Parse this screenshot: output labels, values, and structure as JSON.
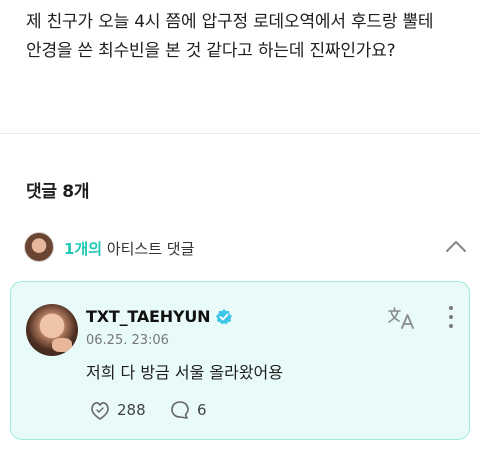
{
  "post": {
    "text": "제 친구가 오늘 4시 쯤에 압구정 로데오역에서 후드랑 뿔테 안경을 쓴 최수빈을 본 것 같다고 하는데 진짜인가요?"
  },
  "comments_header": "댓글 8개",
  "artist_comments": {
    "count": "1개의",
    "label": " 아티스트 댓글",
    "accent_color": "#1ec8b4"
  },
  "comment": {
    "author": "TXT_TAEHYUN",
    "timestamp": "06.25. 23:06",
    "body": "저희 다 방금 서울 올라왔어용",
    "likes": "288",
    "replies": "6",
    "icons": {
      "verified": "verified-badge-icon",
      "translate": "translate-icon",
      "more": "more-vertical-icon",
      "like": "like-icon",
      "reply": "reply-icon",
      "collapse": "chevron-up-icon"
    },
    "card_bg": "#e9fbf9",
    "card_border": "#9fe9de"
  }
}
